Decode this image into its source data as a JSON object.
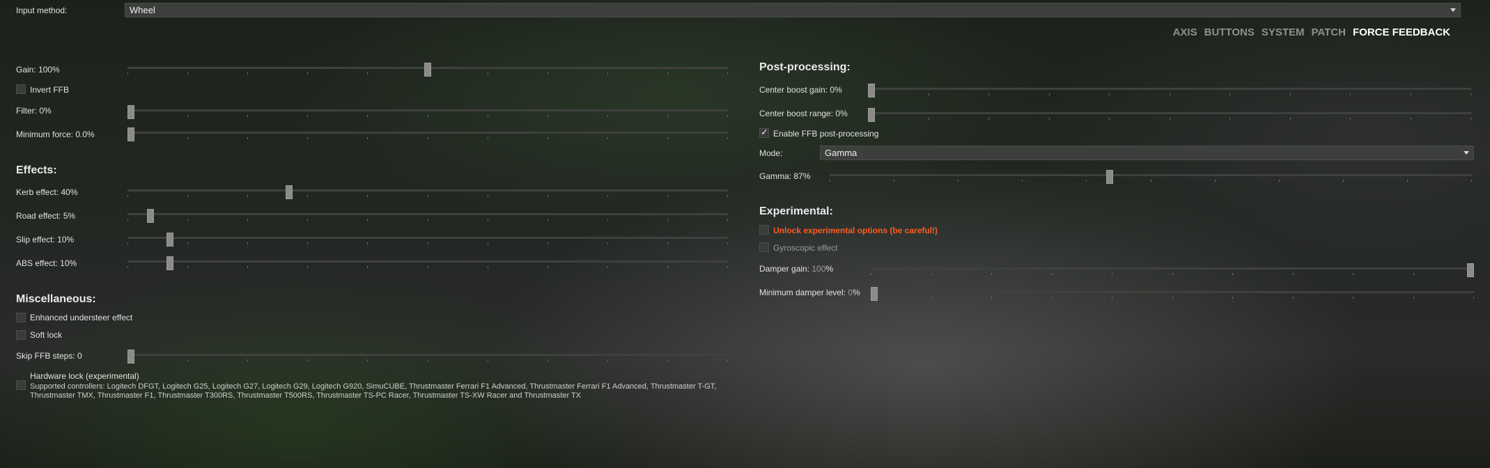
{
  "input_method": {
    "label": "Input method:",
    "value": "Wheel"
  },
  "nav": {
    "tabs": [
      "AXIS",
      "BUTTONS",
      "SYSTEM",
      "PATCH",
      "FORCE FEEDBACK"
    ],
    "active": "FORCE FEEDBACK"
  },
  "left": {
    "gain": {
      "label": "Gain: 100%",
      "value": 0.5
    },
    "invert_ffb": {
      "label": "Invert FFB",
      "checked": false
    },
    "filter": {
      "label": "Filter: 0%",
      "value": 0
    },
    "minimum_force": {
      "label": "Minimum force: 0.0%",
      "value": 0
    },
    "effects": {
      "title": "Effects:",
      "kerb": {
        "label": "Kerb effect: 40%",
        "value": 0.266
      },
      "road": {
        "label": "Road effect: 5%",
        "value": 0.033
      },
      "slip": {
        "label": "Slip effect: 10%",
        "value": 0.066
      },
      "abs": {
        "label": "ABS effect: 10%",
        "value": 0.066
      }
    },
    "misc": {
      "title": "Miscellaneous:",
      "enhanced_understeer": {
        "label": "Enhanced understeer effect",
        "checked": false
      },
      "soft_lock": {
        "label": "Soft lock",
        "checked": false
      },
      "skip_ffb_steps": {
        "label": "Skip FFB steps: 0",
        "value": 0
      },
      "hardware_lock": {
        "label": "Hardware lock (experimental)",
        "checked": false,
        "note": "Supported controllers: Logitech DFGT, Logitech G25, Logitech G27, Logitech G29, Logitech G920, SimuCUBE, Thrustmaster Ferrari F1 Advanced, Thrustmaster Ferrari F1 Advanced, Thrustmaster T-GT, Thrustmaster TMX, Thrustmaster F1, Thrustmaster T300RS, Thrustmaster T500RS, Thrustmaster TS-PC Racer, Thrustmaster TS-XW Racer and Thrustmaster TX"
      }
    }
  },
  "right": {
    "post": {
      "title": "Post-processing:",
      "center_boost_gain": {
        "label": "Center boost gain: 0%",
        "value": 0
      },
      "center_boost_range": {
        "label": "Center boost range: 0%",
        "value": 0
      },
      "enable_post": {
        "label": "Enable FFB post-processing",
        "checked": true
      },
      "mode": {
        "label": "Mode:",
        "value": "Gamma"
      },
      "gamma": {
        "label": "Gamma: 87%",
        "value": 0.435
      }
    },
    "experimental": {
      "title": "Experimental:",
      "unlock": {
        "label": "Unlock experimental options (be careful!)",
        "checked": false
      },
      "gyroscopic": {
        "label": "Gyroscopic effect",
        "checked": false
      },
      "damper_gain": {
        "label_prefix": "Damper gain: ",
        "label_value": "100",
        "label_suffix": "%",
        "value": 1.0
      },
      "min_damper": {
        "label_prefix": "Minimum damper level: ",
        "label_value": "0",
        "label_suffix": "%",
        "value": 0
      }
    }
  }
}
